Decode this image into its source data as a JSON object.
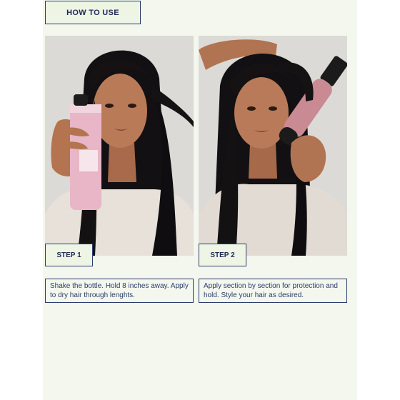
{
  "section": {
    "title": "HOW TO USE"
  },
  "steps": [
    {
      "label": "STEP 1",
      "instruction": "Shake the bottle. Hold 8 inches away. Apply to dry hair through lenghts."
    },
    {
      "label": "STEP 2",
      "instruction": "Apply section by section for protection and hold. Style your hair as desired."
    }
  ],
  "colors": {
    "background": "#f3f7ee",
    "accent": "#2b3b6b",
    "badge_fill": "#eef5e4"
  }
}
